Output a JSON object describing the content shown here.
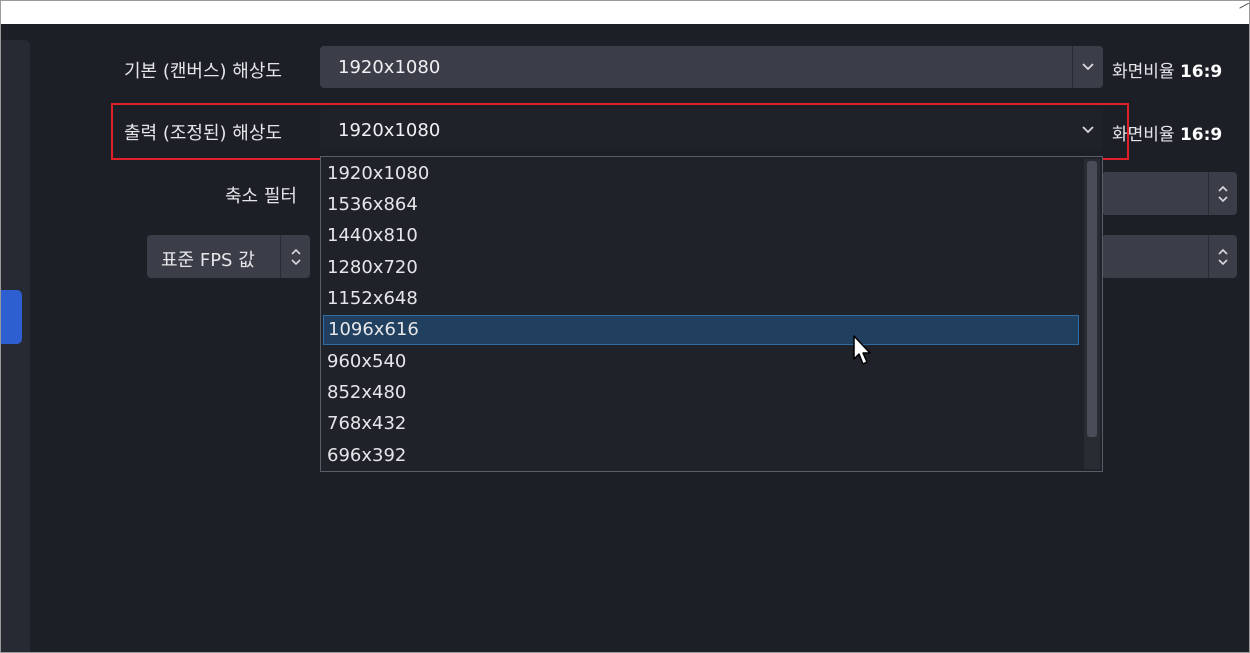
{
  "video_settings": {
    "base_resolution": {
      "label": "기본 (캔버스) 해상도",
      "value": "1920x1080",
      "aspect_label": "화면비율",
      "aspect_value": "16:9"
    },
    "output_resolution": {
      "label": "출력 (조정된) 해상도",
      "value": "1920x1080",
      "aspect_label": "화면비율",
      "aspect_value": "16:9",
      "options": [
        "1920x1080",
        "1536x864",
        "1440x810",
        "1280x720",
        "1152x648",
        "1096x616",
        "960x540",
        "852x480",
        "768x432",
        "696x392"
      ],
      "hovered_option": "1096x616"
    },
    "downscale_filter": {
      "label": "축소 필터"
    },
    "fps": {
      "select_value": "표준 FPS 값"
    }
  },
  "colors": {
    "background": "#1d1f26",
    "input_bg": "#3b3e48",
    "highlight_border": "#e3202a",
    "selected_item_bg": "#213f5e",
    "sidebar_active": "#2d5fd0"
  },
  "icons": {
    "combo_arrow": "chevron-down-icon",
    "spin_arrows": "up-down-chevron-icon",
    "cursor": "mouse-pointer-icon"
  }
}
